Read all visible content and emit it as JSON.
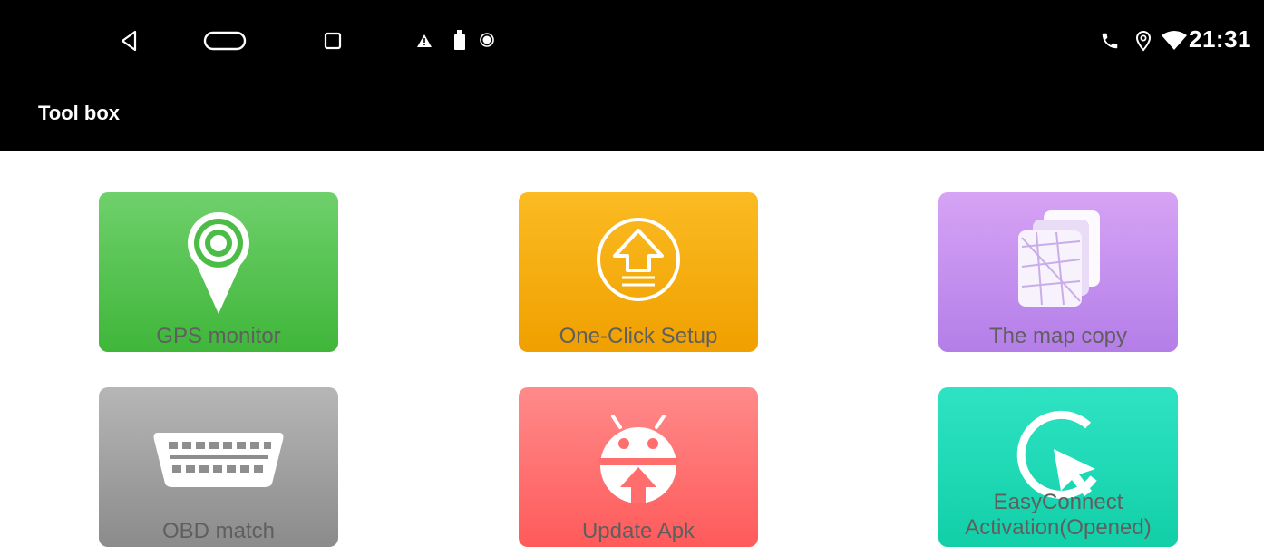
{
  "status_bar": {
    "time": "21:31",
    "nav_icons": [
      "back-icon",
      "home-icon",
      "recents-icon"
    ],
    "notification_icons": [
      "warning-icon",
      "usb-icon",
      "record-icon"
    ],
    "system_icons": [
      "phone-icon",
      "location-icon",
      "wifi-icon"
    ]
  },
  "app_bar": {
    "title": "Tool box"
  },
  "tools": [
    {
      "label": "GPS monitor",
      "icon": "gps-pin-icon",
      "color": "#4bbd46"
    },
    {
      "label": "One-Click Setup",
      "icon": "upload-arrow-icon",
      "color": "#f5ac0e"
    },
    {
      "label": "The map copy",
      "icon": "map-copy-icon",
      "color": "#c391ee"
    },
    {
      "label": "OBD match",
      "icon": "obd-connector-icon",
      "color": "#9e9e9e"
    },
    {
      "label": "Update Apk",
      "icon": "android-update-icon",
      "color": "#ff6d6d"
    },
    {
      "label_line1": "EasyConnect",
      "label_line2": "Activation(Opened)",
      "icon": "cursor-ring-icon",
      "color": "#1dd9b5"
    }
  ]
}
